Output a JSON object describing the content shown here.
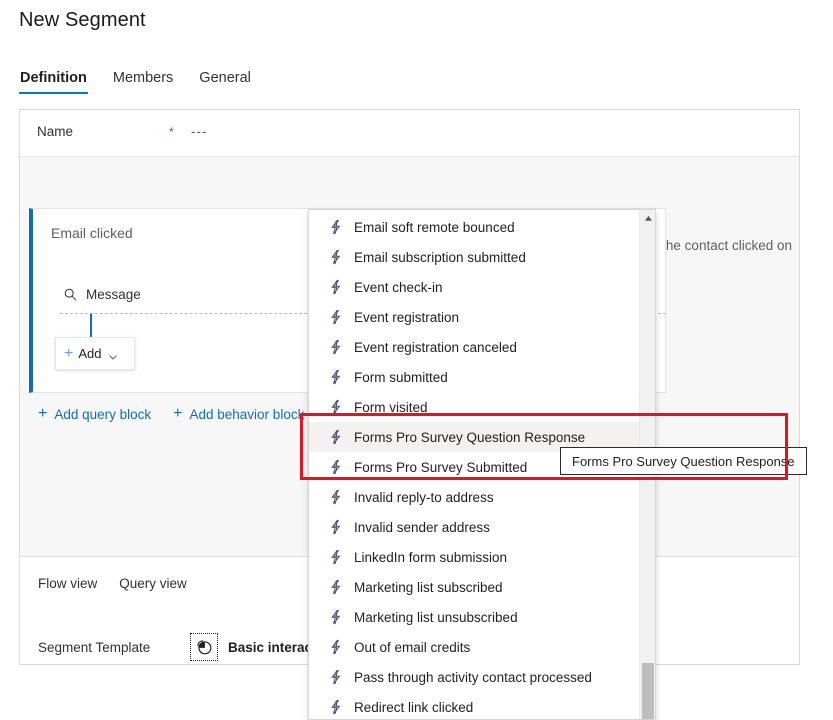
{
  "page": {
    "title": "New Segment"
  },
  "tabs": [
    {
      "label": "Definition",
      "active": true
    },
    {
      "label": "Members",
      "active": false
    },
    {
      "label": "General",
      "active": false
    }
  ],
  "name_field": {
    "label": "Name",
    "required_marker": "*",
    "value": "---"
  },
  "query_block": {
    "title": "Email clicked",
    "chevron_icon": "chevron-down-icon",
    "search_icon": "search-icon",
    "attribute": "Message",
    "add_button": {
      "plus_icon": "plus-icon",
      "label": "Add",
      "caret_icon": "chevron-down-icon"
    },
    "description_truncated": "ail that the contact clicked on"
  },
  "canvas_actions": [
    {
      "icon": "plus-icon",
      "label": "Add query block"
    },
    {
      "icon": "plus-icon",
      "label": "Add behavior block"
    }
  ],
  "view_tabs": [
    {
      "label": "Flow view"
    },
    {
      "label": "Query view"
    }
  ],
  "segment_template": {
    "label": "Segment Template",
    "chip_icon": "pie-chart-icon",
    "chip_label": "Basic interaction"
  },
  "dropdown": {
    "scroll_up_icon": "caret-up-icon",
    "item_icon": "lightning-bolt-icon",
    "hovered_index": 7,
    "items": [
      {
        "label": "Email soft remote bounced"
      },
      {
        "label": "Email subscription submitted"
      },
      {
        "label": "Event check-in"
      },
      {
        "label": "Event registration"
      },
      {
        "label": "Event registration canceled"
      },
      {
        "label": "Form submitted"
      },
      {
        "label": "Form visited"
      },
      {
        "label": "Forms Pro Survey Question Response"
      },
      {
        "label": "Forms Pro Survey Submitted"
      },
      {
        "label": "Invalid reply-to address"
      },
      {
        "label": "Invalid sender address"
      },
      {
        "label": "LinkedIn form submission"
      },
      {
        "label": "Marketing list subscribed"
      },
      {
        "label": "Marketing list unsubscribed"
      },
      {
        "label": "Out of email credits"
      },
      {
        "label": "Pass through activity contact processed"
      },
      {
        "label": "Redirect link clicked"
      }
    ]
  },
  "tooltip": {
    "text": "Forms Pro Survey Question Response"
  },
  "annotation": {
    "color": "#e81123"
  }
}
